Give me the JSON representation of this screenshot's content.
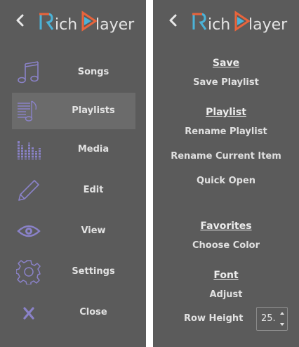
{
  "app": {
    "logo_text": "RichPlayer"
  },
  "left_menu": {
    "items": [
      {
        "label": "Songs",
        "icon": "music-note-icon"
      },
      {
        "label": "Playlists",
        "icon": "playlist-icon",
        "active": true
      },
      {
        "label": "Media",
        "icon": "equalizer-icon"
      },
      {
        "label": "Edit",
        "icon": "pencil-icon"
      },
      {
        "label": "View",
        "icon": "eye-icon"
      },
      {
        "label": "Settings",
        "icon": "gear-icon"
      },
      {
        "label": "Close",
        "icon": "close-icon"
      }
    ]
  },
  "right_menu": {
    "save": {
      "heading": "Save",
      "items": [
        "Save Playlist"
      ]
    },
    "playlist": {
      "heading": "Playlist",
      "items": [
        "Rename Playlist",
        "Rename Current Item",
        "Quick Open"
      ]
    },
    "favorites": {
      "heading": "Favorites",
      "items": [
        "Choose Color"
      ]
    },
    "font": {
      "heading": "Font",
      "items": [
        "Adjust"
      ],
      "row_height_label": "Row Height",
      "row_height_value": "25."
    }
  },
  "colors": {
    "panel_bg": "#5b5b5b",
    "active_bg": "#6b6b6b",
    "icon_purple": "#8a82c8",
    "logo_orange": "#e8643c",
    "logo_blue": "#4bb3d8",
    "text": "#e0e0e0"
  }
}
